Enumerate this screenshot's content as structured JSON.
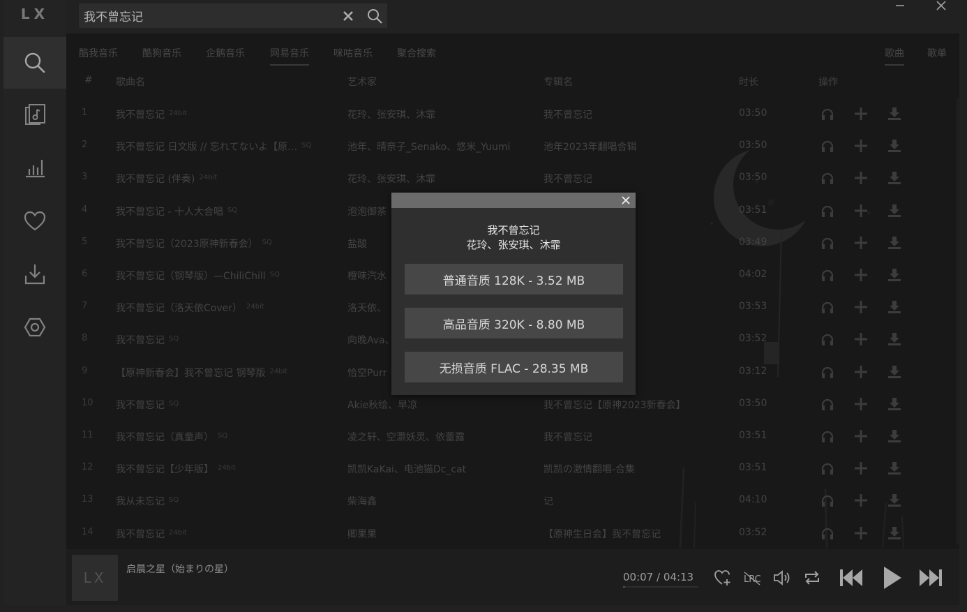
{
  "app": {
    "logo": "LX"
  },
  "sidebar": {
    "items": [
      {
        "name": "search",
        "icon": "search-icon"
      },
      {
        "name": "songlist",
        "icon": "music-file-icon"
      },
      {
        "name": "leaderboard",
        "icon": "bar-chart-icon"
      },
      {
        "name": "favorites",
        "icon": "heart-icon"
      },
      {
        "name": "download",
        "icon": "download-icon"
      },
      {
        "name": "settings",
        "icon": "hexagon-settings-icon"
      }
    ]
  },
  "search": {
    "value": "我不曾忘记"
  },
  "tabs": {
    "sources": [
      "酷我音乐",
      "酷狗音乐",
      "企鹅音乐",
      "网易音乐",
      "咪咕音乐",
      "聚合搜索"
    ],
    "active_source": "网易音乐",
    "types": [
      "歌曲",
      "歌单"
    ],
    "active_type": "歌曲"
  },
  "table": {
    "headers": {
      "index": "#",
      "name": "歌曲名",
      "artist": "艺术家",
      "album": "专辑名",
      "duration": "时长",
      "ops": "操作"
    },
    "rows": [
      {
        "idx": "1",
        "name": "我不曾忘记",
        "quality": "24bit",
        "artist": "花玲、张安琪、沐霏",
        "album": "我不曾忘记",
        "duration": "03:50"
      },
      {
        "idx": "2",
        "name": "我不曾忘记 日文版 // 忘れてないよ【原…",
        "quality": "SQ",
        "artist": "池年、晴奈子_Senako、悠米_Yuumi",
        "album": "池年2023年翻唱合辑",
        "duration": "03:50"
      },
      {
        "idx": "3",
        "name": "我不曾忘记 (伴奏)",
        "quality": "24bit",
        "artist": "花玲、张安琪、沐霏",
        "album": "我不曾忘记",
        "duration": "03:50"
      },
      {
        "idx": "4",
        "name": "我不曾忘记 - 十人大合唱",
        "quality": "SQ",
        "artist": "泡泡御茶",
        "album": "",
        "duration": "03:51"
      },
      {
        "idx": "5",
        "name": "我不曾忘记（2023原神新春会）",
        "quality": "SQ",
        "artist": "盐酸",
        "album": "",
        "duration": "03:49"
      },
      {
        "idx": "6",
        "name": "我不曾忘记（钢琴版）—ChiliChill",
        "quality": "SQ",
        "artist": "橙味汽水",
        "album": "",
        "duration": "04:02"
      },
      {
        "idx": "7",
        "name": "我不曾忘记（洛天依Cover）",
        "quality": "24bit",
        "artist": "洛天依、",
        "album": "）",
        "duration": "03:53"
      },
      {
        "idx": "8",
        "name": "我不曾忘记",
        "quality": "SQ",
        "artist": "向晚Ava、",
        "album": "",
        "duration": "03:52"
      },
      {
        "idx": "9",
        "name": "【原神新春会】我不曾忘记 钢琴版",
        "quality": "24bit",
        "artist": "恰空Purr",
        "album": "",
        "duration": "03:12"
      },
      {
        "idx": "10",
        "name": "我不曾忘记",
        "quality": "SQ",
        "artist": "Akie秋绘、早凉",
        "album": "我不曾忘记【原神2023新春会】",
        "duration": "03:50"
      },
      {
        "idx": "11",
        "name": "我不曾忘记（真童声）",
        "quality": "SQ",
        "artist": "凌之轩、空灏妖灵、依蕾露",
        "album": "我不曾忘记",
        "duration": "03:51"
      },
      {
        "idx": "12",
        "name": "我不曾忘记【少年版】",
        "quality": "24bit",
        "artist": "凯凯KaKai、电池猫Dc_cat",
        "album": "凯凯の激情翻唱-合集",
        "duration": "03:51"
      },
      {
        "idx": "13",
        "name": "我从未忘记",
        "quality": "SQ",
        "artist": "柴海鑫",
        "album": "记",
        "duration": "04:10"
      },
      {
        "idx": "14",
        "name": "我不曾忘记",
        "quality": "24bit",
        "artist": "卿果果",
        "album": "【原神生日会】我不曾忘记",
        "duration": "03:52"
      }
    ]
  },
  "player": {
    "cover_text": "LX",
    "title": "启晨之星（始まりの星）",
    "current_time": "00:07",
    "separator": "/",
    "total_time": "04:13",
    "progress": 0.028
  },
  "modal": {
    "title": "我不曾忘记",
    "artist": "花玲、张安琪、沐霏",
    "options": [
      {
        "label": "普通音质 128K - 3.52 MB"
      },
      {
        "label": "高品音质 320K - 8.80 MB"
      },
      {
        "label": "无损音质 FLAC - 28.35 MB"
      }
    ]
  }
}
